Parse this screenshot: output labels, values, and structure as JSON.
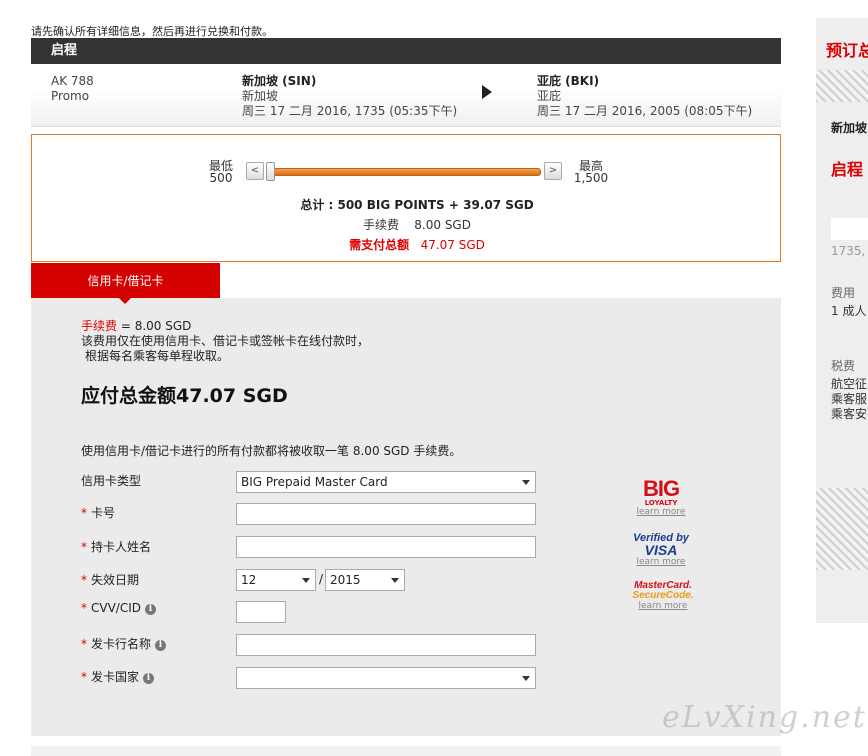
{
  "intro_text": "请先确认所有详细信息，然后再进行兑换和付款。",
  "departure": {
    "header": "启程",
    "flight_no": "AK 788",
    "fare_type": "Promo",
    "origin_name": "新加坡 (SIN)",
    "origin_sub": "新加坡",
    "origin_time": "周三 17 二月 2016, 1735 (05:35下午)",
    "dest_name": "亚庇 (BKI)",
    "dest_sub": "亚庇",
    "dest_time": "周三 17 二月 2016, 2005 (08:05下午)"
  },
  "points": {
    "min_label": "最低",
    "min_value": "500",
    "max_label": "最高",
    "max_value": "1,500",
    "slider_value": 500,
    "slider_min": 500,
    "slider_max": 1500,
    "total_label": "总计 :",
    "total_value": "500 BIG POINTS + 39.07 SGD",
    "fee_label": "手续费",
    "fee_value": "8.00 SGD",
    "due_label": "需支付总额",
    "due_value": "47.07 SGD"
  },
  "tab_label": "信用卡/借记卡",
  "payment": {
    "fee_note_label": "手续费",
    "fee_note_value": " = 8.00 SGD",
    "fee_note_line2": "该费用仅在使用信用卡、借记卡或签帐卡在线付款时，",
    "fee_note_line3": "根据每名乘客每单程收取。",
    "amount_title": "应付总金额47.07 SGD",
    "notice": "使用信用卡/借记卡进行的所有付款都将被收取一笔 8.00 SGD 手续费。",
    "card_type_label": "信用卡类型",
    "card_type_value": "BIG Prepaid Master Card",
    "card_no_label": "卡号",
    "holder_label": "持卡人姓名",
    "expiry_label": "失效日期",
    "expiry_month": "12",
    "expiry_sep": "/",
    "expiry_year": "2015",
    "cvv_label": "CVV/CID",
    "bank_label": "发卡行名称",
    "country_label": "发卡国家"
  },
  "logos": {
    "big_word": "BIG",
    "big_sub": "LOYALTY",
    "visa_line1": "Verified by",
    "visa_line2": "VISA",
    "mc_line1": "MasterCard.",
    "mc_line2": "SecureCode.",
    "learn_more": "learn more"
  },
  "sidebar": {
    "title": "预订总",
    "route": "新加坡",
    "departure": "启程",
    "time": "1735, 2",
    "fare_label": "费用",
    "adult": "1 成人",
    "tax_label": "税费",
    "tax_1": "航空征",
    "tax_2": "乘客服",
    "tax_3": "乘客安"
  },
  "watermark": "eLvXing.net",
  "colors": {
    "brand_red": "#d50000",
    "orange_border": "#e07a2a",
    "header_dark": "#333333"
  }
}
